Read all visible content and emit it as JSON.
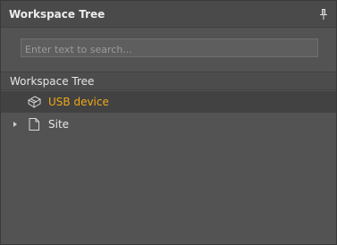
{
  "panel": {
    "title": "Workspace Tree",
    "pin_icon": "pin-icon"
  },
  "search": {
    "placeholder": "Enter text to search...",
    "value": ""
  },
  "tree": {
    "header": "Workspace Tree",
    "items": [
      {
        "label": "USB device",
        "icon": "usb-device-icon",
        "selected": true,
        "expandable": false,
        "label_color": "#f0a818"
      },
      {
        "label": "Site",
        "icon": "document-icon",
        "selected": false,
        "expandable": true,
        "label_color": "#e6e6e6"
      }
    ]
  },
  "colors": {
    "background": "#535353",
    "title_bar": "#4a4a4a",
    "selected_row": "#424242",
    "accent": "#f0a818"
  }
}
